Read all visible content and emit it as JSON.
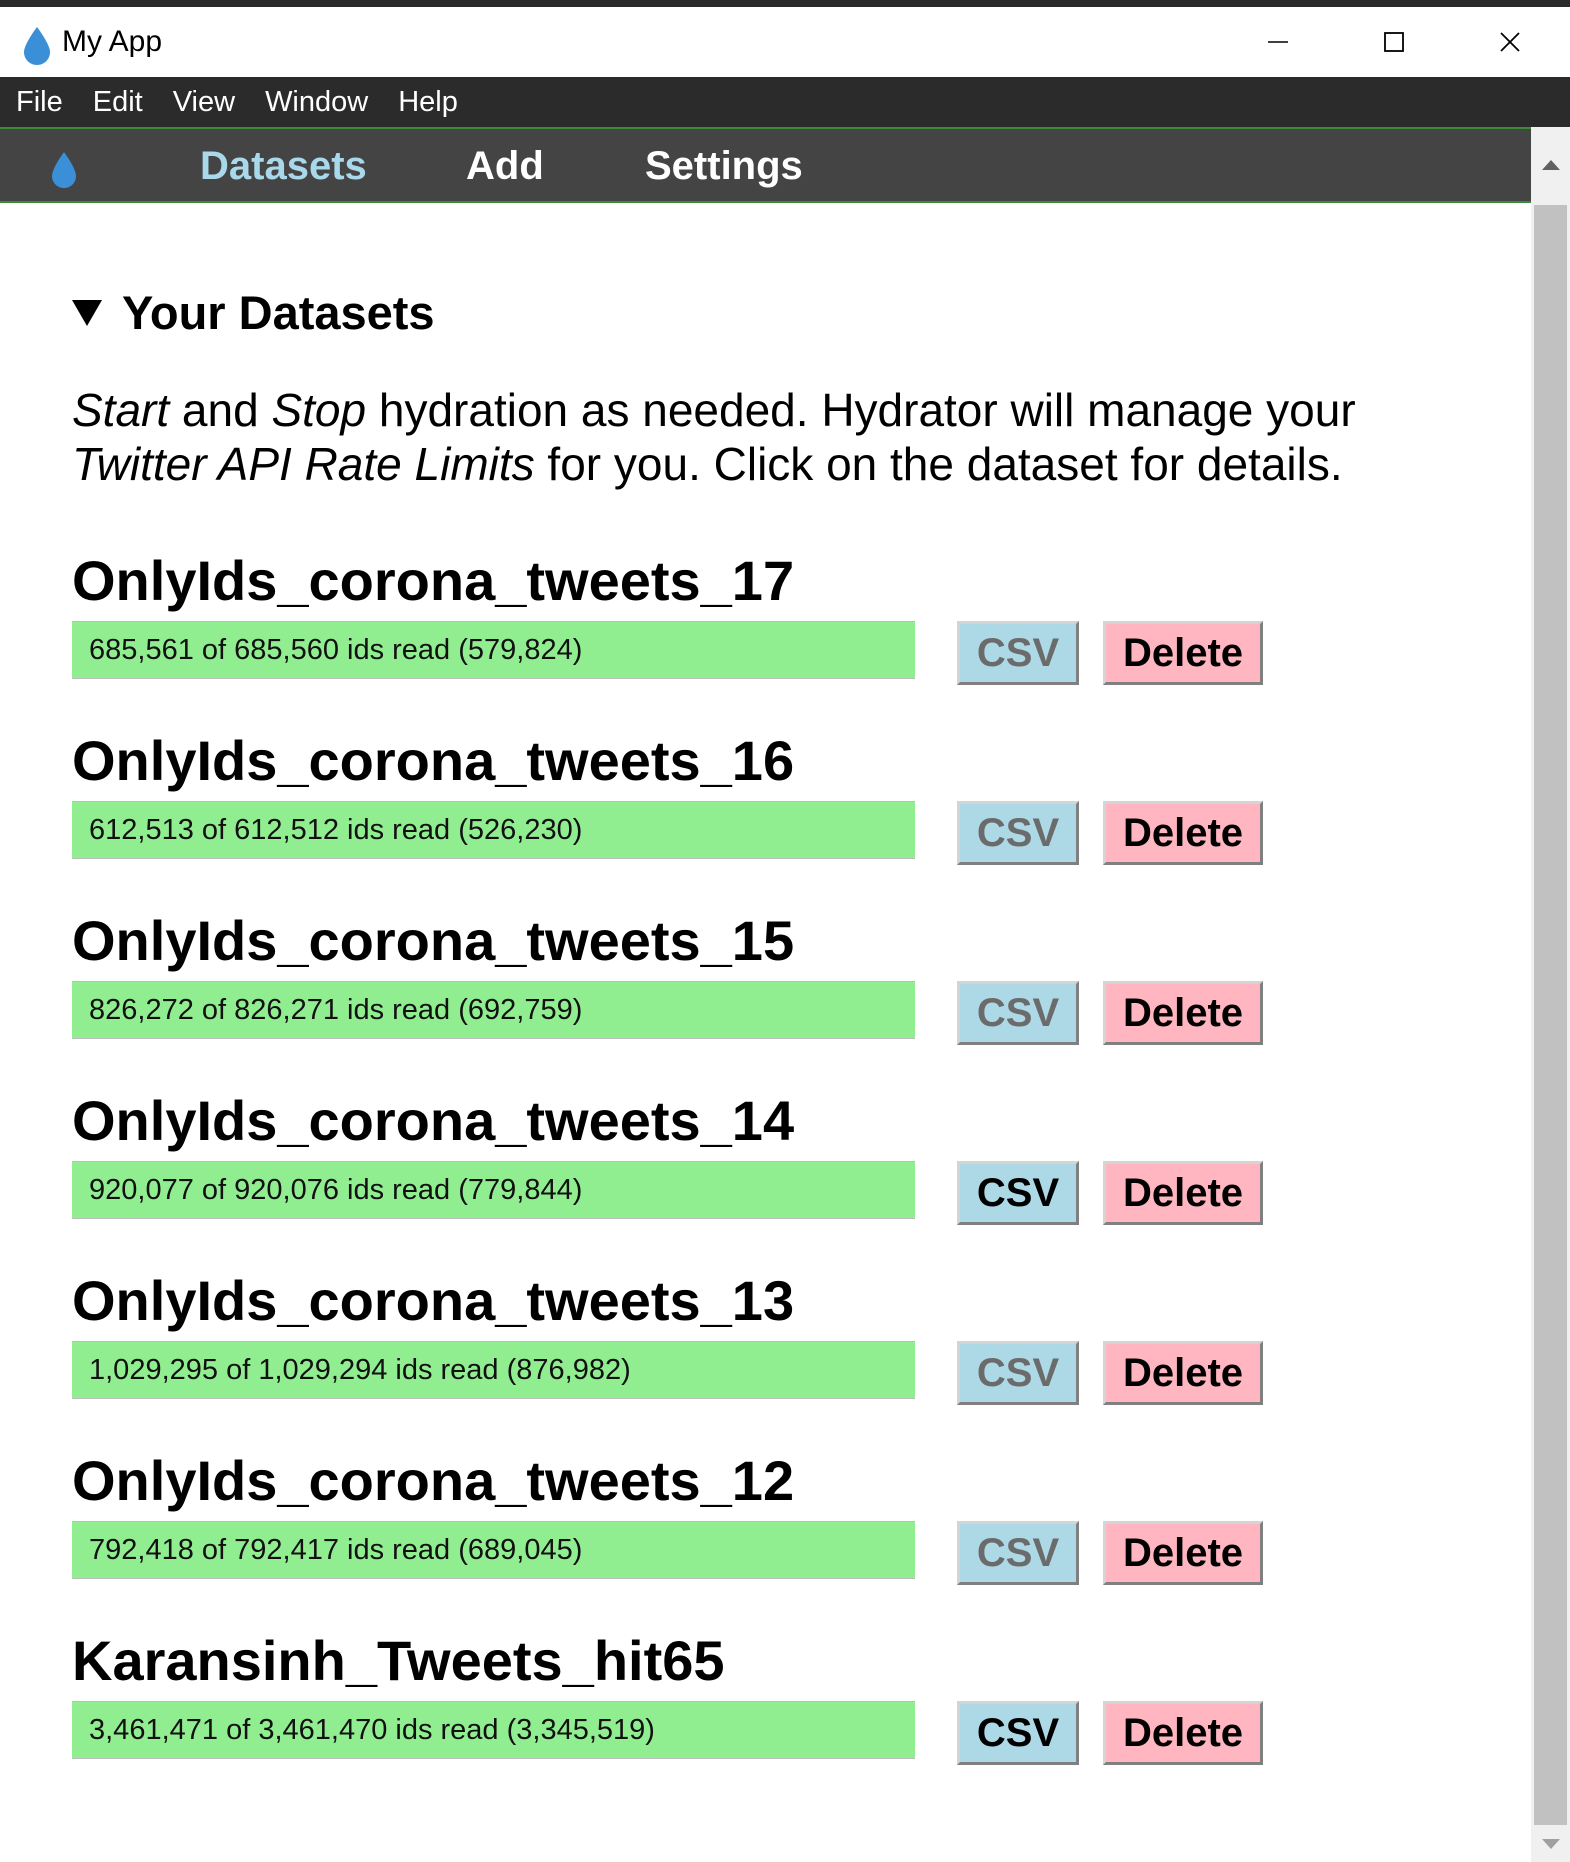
{
  "window": {
    "title": "My App",
    "icon": "water-drop-icon",
    "controls": [
      "minimize-icon",
      "maximize-icon",
      "close-icon"
    ]
  },
  "menu": [
    "File",
    "Edit",
    "View",
    "Window",
    "Help"
  ],
  "nav": {
    "logo": "water-drop-icon",
    "links": [
      "Datasets",
      "Add",
      "Settings"
    ],
    "active": "Datasets"
  },
  "section": {
    "title": "Your Datasets",
    "intro": {
      "start": "Start",
      "and": " and ",
      "stop": "Stop",
      "rest1": " hydration as needed. Hydrator will manage your ",
      "limits": "Twitter API Rate Limits",
      "rest2": " for you. Click on the dataset for details."
    }
  },
  "datasets": [
    {
      "name": "OnlyIds_corona_tweets_17",
      "progress_text": "685,561 of 685,560 ids read (579,824)",
      "progress": 1.0,
      "csv_label": "CSV",
      "csv_enabled": false,
      "delete_label": "Delete"
    },
    {
      "name": "OnlyIds_corona_tweets_16",
      "progress_text": "612,513 of 612,512 ids read (526,230)",
      "progress": 1.0,
      "csv_label": "CSV",
      "csv_enabled": false,
      "delete_label": "Delete"
    },
    {
      "name": "OnlyIds_corona_tweets_15",
      "progress_text": "826,272 of 826,271 ids read (692,759)",
      "progress": 1.0,
      "csv_label": "CSV",
      "csv_enabled": false,
      "delete_label": "Delete"
    },
    {
      "name": "OnlyIds_corona_tweets_14",
      "progress_text": "920,077 of 920,076 ids read (779,844)",
      "progress": 1.0,
      "csv_label": "CSV",
      "csv_enabled": true,
      "delete_label": "Delete"
    },
    {
      "name": "OnlyIds_corona_tweets_13",
      "progress_text": "1,029,295 of 1,029,294 ids read (876,982)",
      "progress": 1.0,
      "csv_label": "CSV",
      "csv_enabled": false,
      "delete_label": "Delete"
    },
    {
      "name": "OnlyIds_corona_tweets_12",
      "progress_text": "792,418 of 792,417 ids read (689,045)",
      "progress": 1.0,
      "csv_label": "CSV",
      "csv_enabled": false,
      "delete_label": "Delete"
    },
    {
      "name": "Karansinh_Tweets_hit65",
      "progress_text": "3,461,471 of 3,461,470 ids read (3,345,519)",
      "progress": 1.0,
      "csv_label": "CSV",
      "csv_enabled": true,
      "delete_label": "Delete"
    }
  ],
  "colors": {
    "progress_fill": "#90ee90",
    "csv_bg": "#add8e6",
    "csv_text_enabled": "#000000",
    "csv_text_disabled": "#6b6b6b",
    "delete_bg": "#ffb6c1",
    "nav_bg": "#444444",
    "nav_active": "#a8d8ea",
    "menubar_bg": "#2b2b2b"
  }
}
